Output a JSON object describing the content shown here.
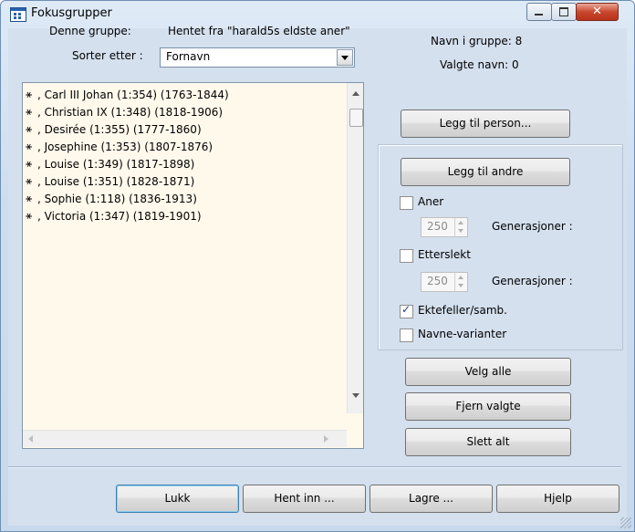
{
  "window": {
    "title": "Fokusgrupper",
    "close_glyph": "✕"
  },
  "group_label": "Denne gruppe:",
  "group_value": "Hentet fra \"harald5s eldste aner\"",
  "sort_label": "Sorter etter :",
  "sort_value": "Fornavn",
  "counts": {
    "names_in_group": "Navn i gruppe: 8",
    "selected_names": "Valgte navn: 0"
  },
  "list": {
    "icon": "⚹",
    "items": [
      ", Carl III Johan (1:354) (1763-1844)",
      ", Christian IX (1:348) (1818-1906)",
      ", Desirée (1:355) (1777-1860)",
      ", Josephine (1:353) (1807-1876)",
      ", Louise (1:349) (1817-1898)",
      ", Louise (1:351) (1828-1871)",
      ", Sophie (1:118) (1836-1913)",
      ", Victoria (1:347) (1819-1901)"
    ]
  },
  "buttons": {
    "add_person": "Legg til person...",
    "add_others": "Legg til andre",
    "select_all": "Velg alle",
    "remove_selected": "Fjern valgte",
    "delete_all": "Slett alt",
    "close": "Lukk",
    "load": "Hent inn ...",
    "save": "Lagre ...",
    "help": "Hjelp"
  },
  "options": {
    "ancestors": {
      "label": "Aner",
      "checked": false,
      "generations": "250",
      "gen_label": "Generasjoner :"
    },
    "descendants": {
      "label": "Etterslekt",
      "checked": false,
      "generations": "250",
      "gen_label": "Generasjoner :"
    },
    "spouses": {
      "label": "Ektefeller/samb.",
      "checked": true
    },
    "name_variants": {
      "label": "Navne-varianter",
      "checked": false
    }
  }
}
